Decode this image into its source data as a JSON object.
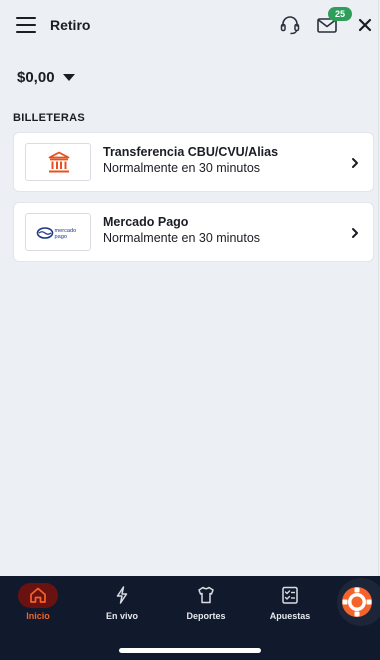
{
  "header": {
    "title": "Retiro",
    "menu_icon": "hamburger-menu-icon",
    "support_icon": "headset-icon",
    "mail_icon": "envelope-icon",
    "mail_badge": "25",
    "close_icon": "close-icon"
  },
  "balance": {
    "amount": "$0,00",
    "caret_icon": "caret-down-icon"
  },
  "wallets": {
    "heading": "BILLETERAS",
    "items": [
      {
        "title": "Transferencia CBU/CVU/Alias",
        "subtitle": "Normalmente en 30 minutos",
        "logo_icon": "bank-icon"
      },
      {
        "title": "Mercado Pago",
        "subtitle": "Normalmente en 30 minutos",
        "logo_icon": "mercado-pago-logo",
        "logo_text": "mercado pago"
      }
    ]
  },
  "bottom_nav": {
    "items": [
      {
        "label": "Inicio",
        "icon": "home-icon",
        "active": true
      },
      {
        "label": "En vivo",
        "icon": "lightning-icon",
        "active": false
      },
      {
        "label": "Deportes",
        "icon": "jersey-icon",
        "active": false
      },
      {
        "label": "Apuestas",
        "icon": "betslip-icon",
        "active": false
      }
    ],
    "casino_icon": "casino-chip-icon"
  },
  "colors": {
    "background": "#eceff3",
    "card": "#ffffff",
    "nav_background": "#111a2c",
    "accent": "#f5632a",
    "active_pill": "#6a1212",
    "badge": "#2e9e5b"
  }
}
